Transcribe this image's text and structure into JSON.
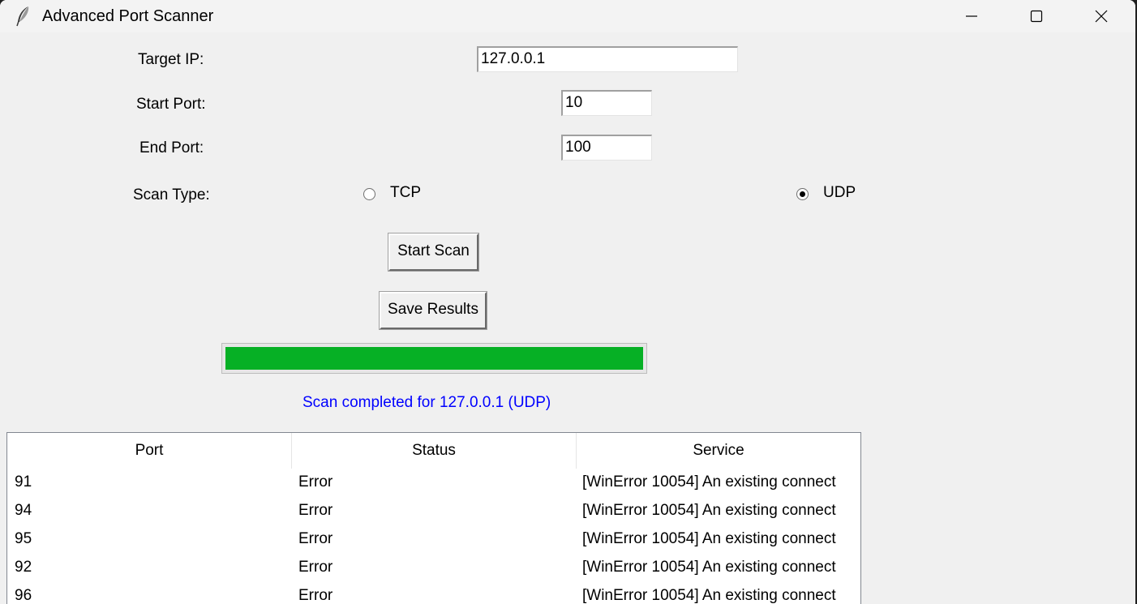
{
  "window": {
    "title": "Advanced Port Scanner"
  },
  "form": {
    "target_ip_label": "Target IP:",
    "target_ip_value": "127.0.0.1",
    "start_port_label": "Start Port:",
    "start_port_value": "10",
    "end_port_label": "End Port:",
    "end_port_value": "100",
    "scan_type_label": "Scan Type:",
    "scan_type_options": [
      {
        "label": "TCP",
        "selected": false
      },
      {
        "label": "UDP",
        "selected": true
      }
    ]
  },
  "buttons": {
    "start_scan": "Start Scan",
    "save_results": "Save Results"
  },
  "progress": {
    "value_percent": 100,
    "color": "#06b025"
  },
  "status": {
    "text": "Scan completed for 127.0.0.1 (UDP)",
    "color": "#0000ff"
  },
  "results": {
    "columns": [
      "Port",
      "Status",
      "Service"
    ],
    "rows": [
      {
        "port": "91",
        "status": "Error",
        "service": "[WinError 10054] An existing connect"
      },
      {
        "port": "94",
        "status": "Error",
        "service": "[WinError 10054] An existing connect"
      },
      {
        "port": "95",
        "status": "Error",
        "service": "[WinError 10054] An existing connect"
      },
      {
        "port": "92",
        "status": "Error",
        "service": "[WinError 10054] An existing connect"
      },
      {
        "port": "96",
        "status": "Error",
        "service": "[WinError 10054] An existing connect"
      }
    ]
  },
  "icons": {
    "app": "feather-icon",
    "minimize": "minimize-icon",
    "maximize": "maximize-icon",
    "close": "close-icon"
  }
}
